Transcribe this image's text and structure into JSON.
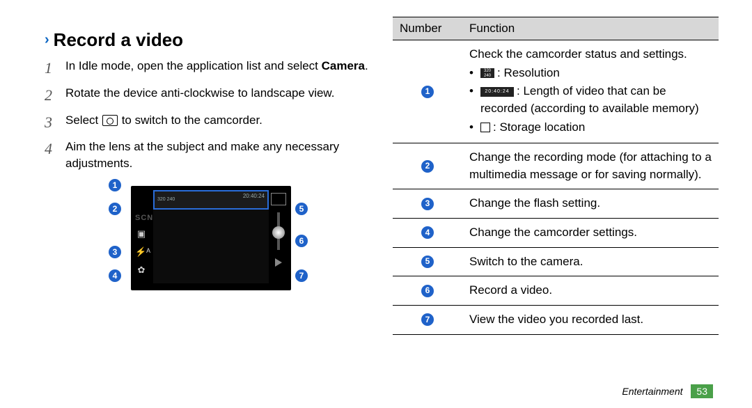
{
  "heading": "Record a video",
  "steps": [
    {
      "num": "1",
      "pre": "In Idle mode, open the application list and select ",
      "bold": "Camera",
      "post": "."
    },
    {
      "num": "2",
      "text": "Rotate the device anti-clockwise to landscape view."
    },
    {
      "num": "3",
      "pre": "Select ",
      "post": " to switch to the camcorder.",
      "iconName": "camera-icon"
    },
    {
      "num": "4",
      "text": "Aim the lens at the subject and make any necessary adjustments."
    }
  ],
  "figure": {
    "callouts": [
      "1",
      "2",
      "3",
      "4",
      "5",
      "6",
      "7"
    ],
    "topbar_left": "320\n240",
    "topbar_right": "20:40:24"
  },
  "table": {
    "head": {
      "c1": "Number",
      "c2": "Function"
    },
    "rows": [
      {
        "n": "1",
        "intro": "Check the camcorder status and settings.",
        "bullets": [
          {
            "iconName": "resolution-icon",
            "iconText": "320\n240",
            "text": ": Resolution"
          },
          {
            "iconName": "time-icon",
            "iconText": "20:40:24",
            "text": ": Length of video that can be recorded (according to available memory)"
          },
          {
            "iconName": "storage-icon",
            "iconText": "",
            "text": ": Storage location"
          }
        ]
      },
      {
        "n": "2",
        "text": "Change the recording mode (for attaching to a multimedia message or for saving normally)."
      },
      {
        "n": "3",
        "text": "Change the flash setting."
      },
      {
        "n": "4",
        "text": "Change the camcorder settings."
      },
      {
        "n": "5",
        "text": "Switch to the camera."
      },
      {
        "n": "6",
        "text": "Record a video."
      },
      {
        "n": "7",
        "text": "View the video you recorded last."
      }
    ]
  },
  "footer": {
    "section": "Entertainment",
    "page": "53"
  }
}
